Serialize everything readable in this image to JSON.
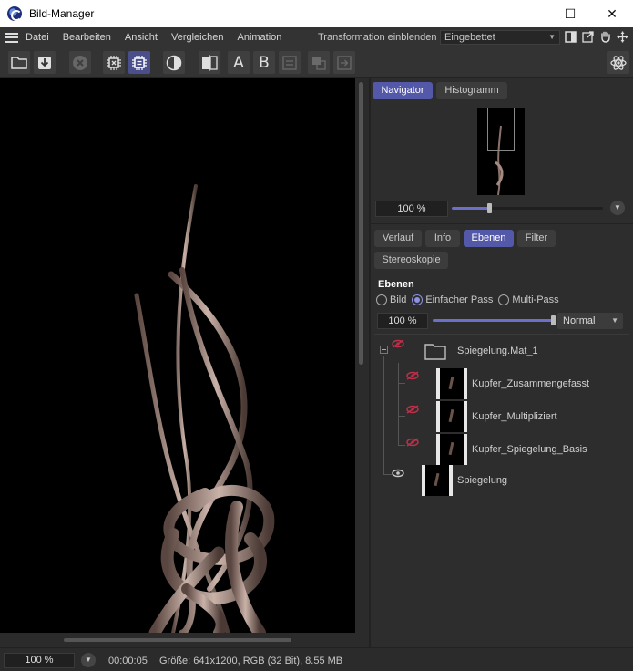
{
  "window": {
    "title": "Bild-Manager",
    "minimize_glyph": "—",
    "maximize_glyph": "☐",
    "close_glyph": "✕"
  },
  "menu": {
    "items": [
      "Datei",
      "Bearbeiten",
      "Ansicht",
      "Vergleichen",
      "Animation"
    ],
    "transform_label": "Transformation einblenden",
    "transform_value": "Eingebettet"
  },
  "toolbar": {
    "letter_a": "A",
    "letter_b": "B"
  },
  "navigator": {
    "tabs": [
      "Navigator",
      "Histogramm"
    ],
    "active_tab": "Navigator",
    "zoom": "100 %",
    "zoom_slider_fraction": 0.25
  },
  "info_tabs": {
    "tabs": [
      "Verlauf",
      "Info",
      "Ebenen",
      "Filter",
      "Stereoskopie"
    ],
    "active_tab": "Ebenen"
  },
  "layers": {
    "title": "Ebenen",
    "modes": [
      "Bild",
      "Einfacher Pass",
      "Multi-Pass"
    ],
    "selected_mode": "Einfacher Pass",
    "opacity": "100 %",
    "opacity_fraction": 1.0,
    "blend_mode": "Normal",
    "items": [
      {
        "name": "Spiegelung.Mat_1",
        "visible": false,
        "folder": true
      },
      {
        "name": "Kupfer_Zusammengefasst",
        "visible": false,
        "folder": false
      },
      {
        "name": "Kupfer_Multipliziert",
        "visible": false,
        "folder": false
      },
      {
        "name": "Kupfer_Spiegelung_Basis",
        "visible": false,
        "folder": false
      },
      {
        "name": "Spiegelung",
        "visible": true,
        "folder": false
      }
    ]
  },
  "statusbar": {
    "zoom": "100 %",
    "time": "00:00:05",
    "info": "Größe: 641x1200, RGB (32 Bit), 8.55 MB"
  },
  "colors": {
    "accent": "#5358a8",
    "hidden_eye": "#c0304a",
    "visible_eye": "#c8c8c8"
  }
}
